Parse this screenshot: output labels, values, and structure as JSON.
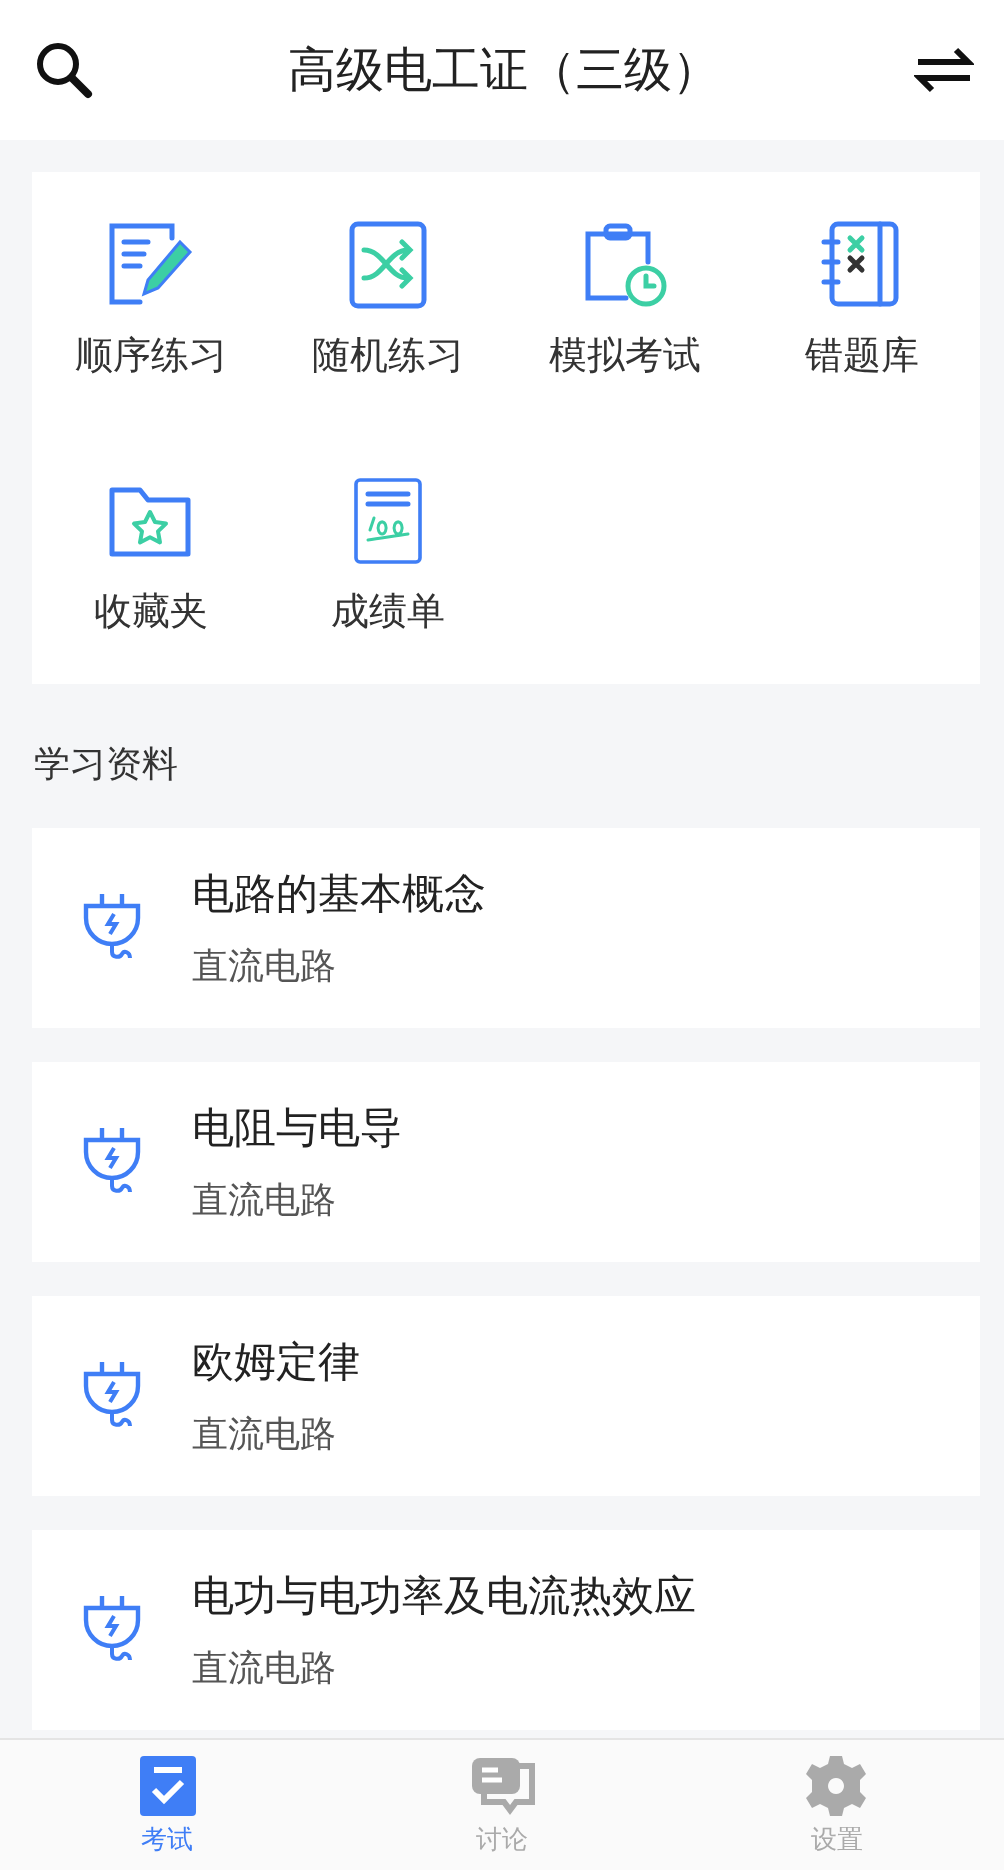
{
  "header": {
    "title": "高级电工证（三级）"
  },
  "shortcuts": [
    {
      "kind": "edit",
      "label": "顺序练习"
    },
    {
      "kind": "shuffle",
      "label": "随机练习"
    },
    {
      "kind": "clipboard",
      "label": "模拟考试"
    },
    {
      "kind": "notebook",
      "label": "错题库"
    },
    {
      "kind": "folder",
      "label": "收藏夹"
    },
    {
      "kind": "score",
      "label": "成绩单"
    }
  ],
  "section_title": "学习资料",
  "materials": [
    {
      "title": "电路的基本概念",
      "subtitle": "直流电路"
    },
    {
      "title": "电阻与电导",
      "subtitle": "直流电路"
    },
    {
      "title": "欧姆定律",
      "subtitle": "直流电路"
    },
    {
      "title": "电功与电功率及电流热效应",
      "subtitle": "直流电路"
    }
  ],
  "tabs": [
    {
      "kind": "exam",
      "label": "考试",
      "selected": true
    },
    {
      "kind": "chat",
      "label": "讨论",
      "selected": false
    },
    {
      "kind": "settings",
      "label": "设置",
      "selected": false
    }
  ]
}
